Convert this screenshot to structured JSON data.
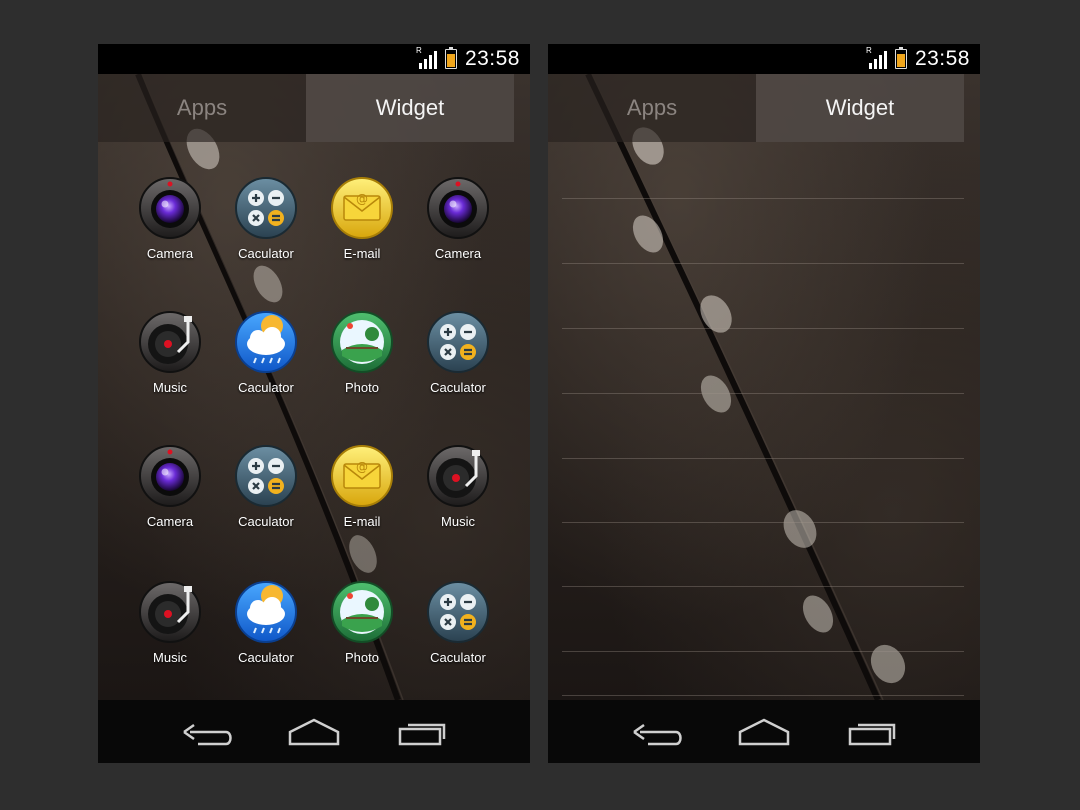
{
  "status": {
    "time": "23:58",
    "network": "R"
  },
  "tabs": [
    {
      "label": "Apps"
    },
    {
      "label": "Widget"
    }
  ],
  "left_screen": {
    "apps": [
      {
        "label": "Camera",
        "icon": "camera-icon"
      },
      {
        "label": "Caculator",
        "icon": "calculator-icon"
      },
      {
        "label": "E-mail",
        "icon": "email-icon"
      },
      {
        "label": "Camera",
        "icon": "camera-icon"
      },
      {
        "label": "Music",
        "icon": "music-icon"
      },
      {
        "label": "Caculator",
        "icon": "weather-icon"
      },
      {
        "label": "Photo",
        "icon": "photo-icon"
      },
      {
        "label": "Caculator",
        "icon": "calculator-icon"
      },
      {
        "label": "Camera",
        "icon": "camera-icon"
      },
      {
        "label": "Caculator",
        "icon": "calculator-icon"
      },
      {
        "label": "E-mail",
        "icon": "email-icon"
      },
      {
        "label": "Music",
        "icon": "music-icon"
      },
      {
        "label": "Music",
        "icon": "music-icon"
      },
      {
        "label": "Caculator",
        "icon": "weather-icon"
      },
      {
        "label": "Photo",
        "icon": "photo-icon"
      },
      {
        "label": "Caculator",
        "icon": "calculator-icon"
      }
    ]
  },
  "navigation": {
    "back": "back-icon",
    "home": "home-icon",
    "recent": "recent-apps-icon"
  },
  "colors": {
    "background": "#2e2e2e",
    "active_tab": "#504945",
    "battery": "#f0a61c"
  }
}
